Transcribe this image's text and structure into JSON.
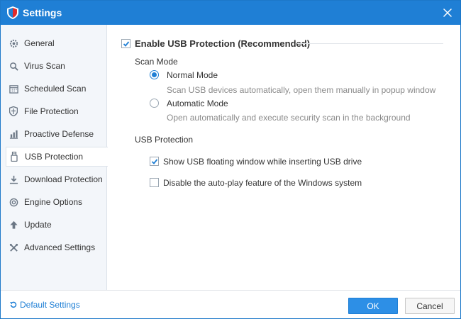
{
  "window": {
    "title": "Settings",
    "icon": "shield-logo-icon",
    "close_icon": "close-icon"
  },
  "sidebar": {
    "items": [
      {
        "label": "General",
        "icon": "gear-icon",
        "active": false
      },
      {
        "label": "Virus Scan",
        "icon": "magnifier-icon",
        "active": false
      },
      {
        "label": "Scheduled Scan",
        "icon": "calendar-icon",
        "active": false
      },
      {
        "label": "File Protection",
        "icon": "shield-icon",
        "active": false
      },
      {
        "label": "Proactive Defense",
        "icon": "chart-icon",
        "active": false
      },
      {
        "label": "USB Protection",
        "icon": "usb-icon",
        "active": true
      },
      {
        "label": "Download Protection",
        "icon": "download-icon",
        "active": false
      },
      {
        "label": "Engine Options",
        "icon": "engine-icon",
        "active": false
      },
      {
        "label": "Update",
        "icon": "update-arrow-icon",
        "active": false
      },
      {
        "label": "Advanced Settings",
        "icon": "tools-icon",
        "active": false
      }
    ]
  },
  "content": {
    "enable": {
      "label": "Enable USB Protection (Recommended)",
      "checked": true
    },
    "scan_mode": {
      "label": "Scan Mode",
      "options": [
        {
          "label": "Normal Mode",
          "description": "Scan USB devices automatically, open them manually in popup window",
          "selected": true
        },
        {
          "label": "Automatic Mode",
          "description": "Open automatically and execute security scan in the background",
          "selected": false
        }
      ]
    },
    "usb_protection": {
      "label": "USB Protection",
      "options": [
        {
          "label": "Show USB floating window while inserting USB drive",
          "checked": true
        },
        {
          "label": "Disable the auto-play feature of the Windows system",
          "checked": false
        }
      ]
    }
  },
  "footer": {
    "default_settings": "Default Settings",
    "ok": "OK",
    "cancel": "Cancel"
  },
  "colors": {
    "accent": "#1f7fd5",
    "sidebar_bg": "#f3f6fa",
    "ok_button": "#2d8fe6"
  }
}
